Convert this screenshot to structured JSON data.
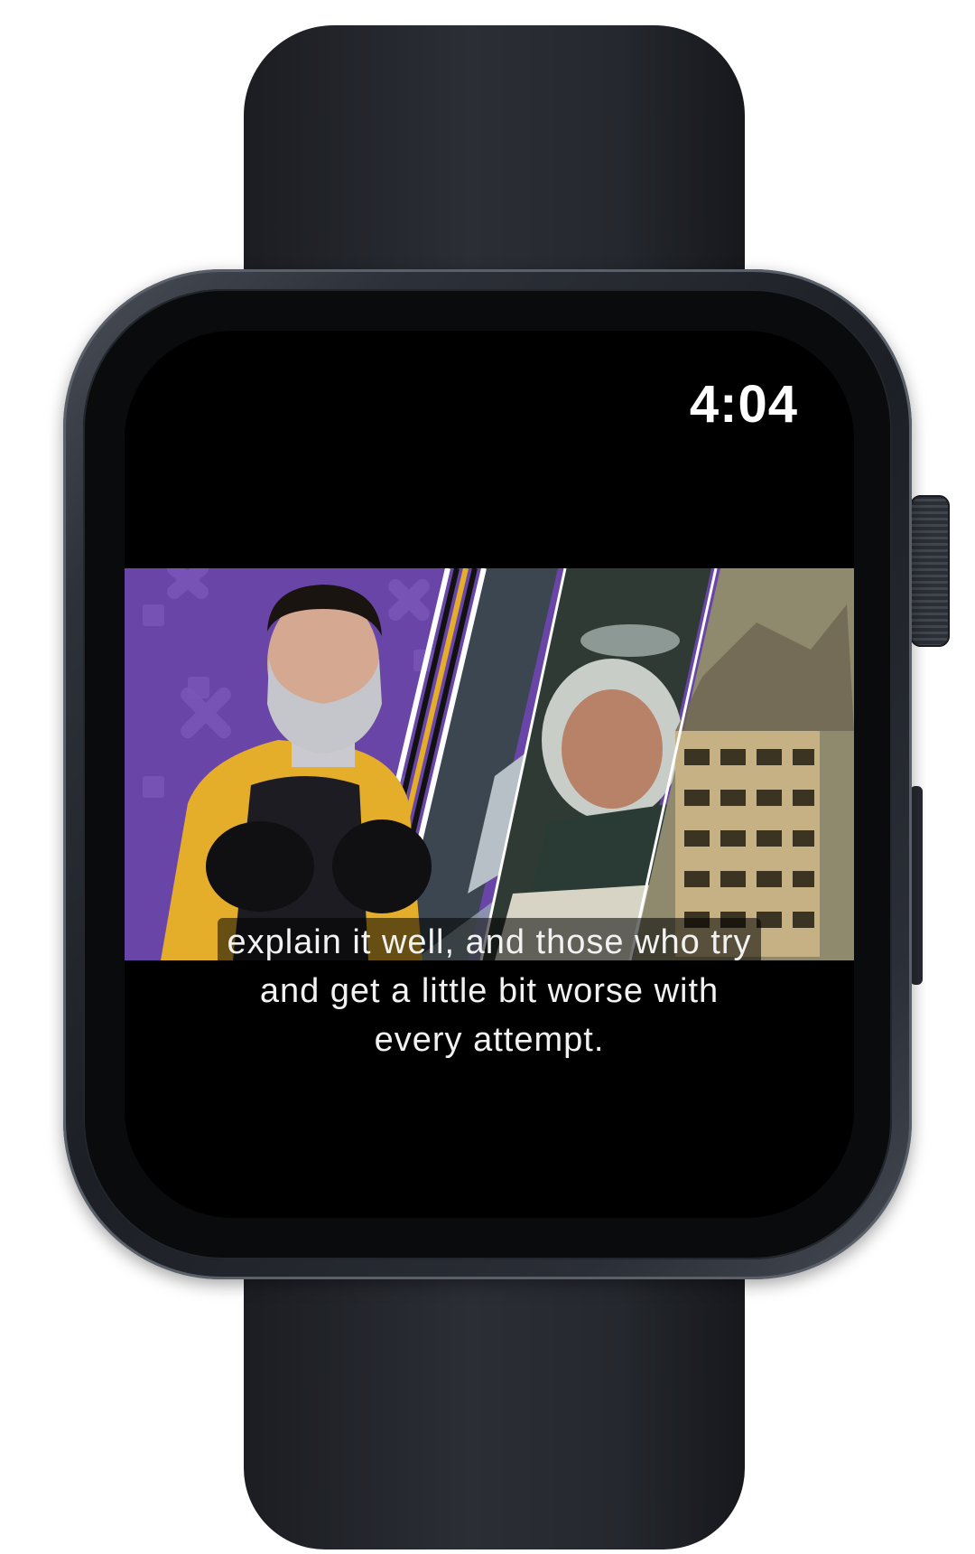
{
  "status_bar": {
    "time": "4:04"
  },
  "video": {
    "description_icon": "video-frame"
  },
  "captions": {
    "lines": [
      "explain it well, and those who try",
      "and get  a little bit worse with",
      "every attempt."
    ]
  },
  "colors": {
    "screen_background": "#000000",
    "caption_text": "#f2f2f2",
    "video_purple": "#6a45a8",
    "jacket_yellow": "#e4ad2a",
    "case_dark": "#1c1f25"
  }
}
